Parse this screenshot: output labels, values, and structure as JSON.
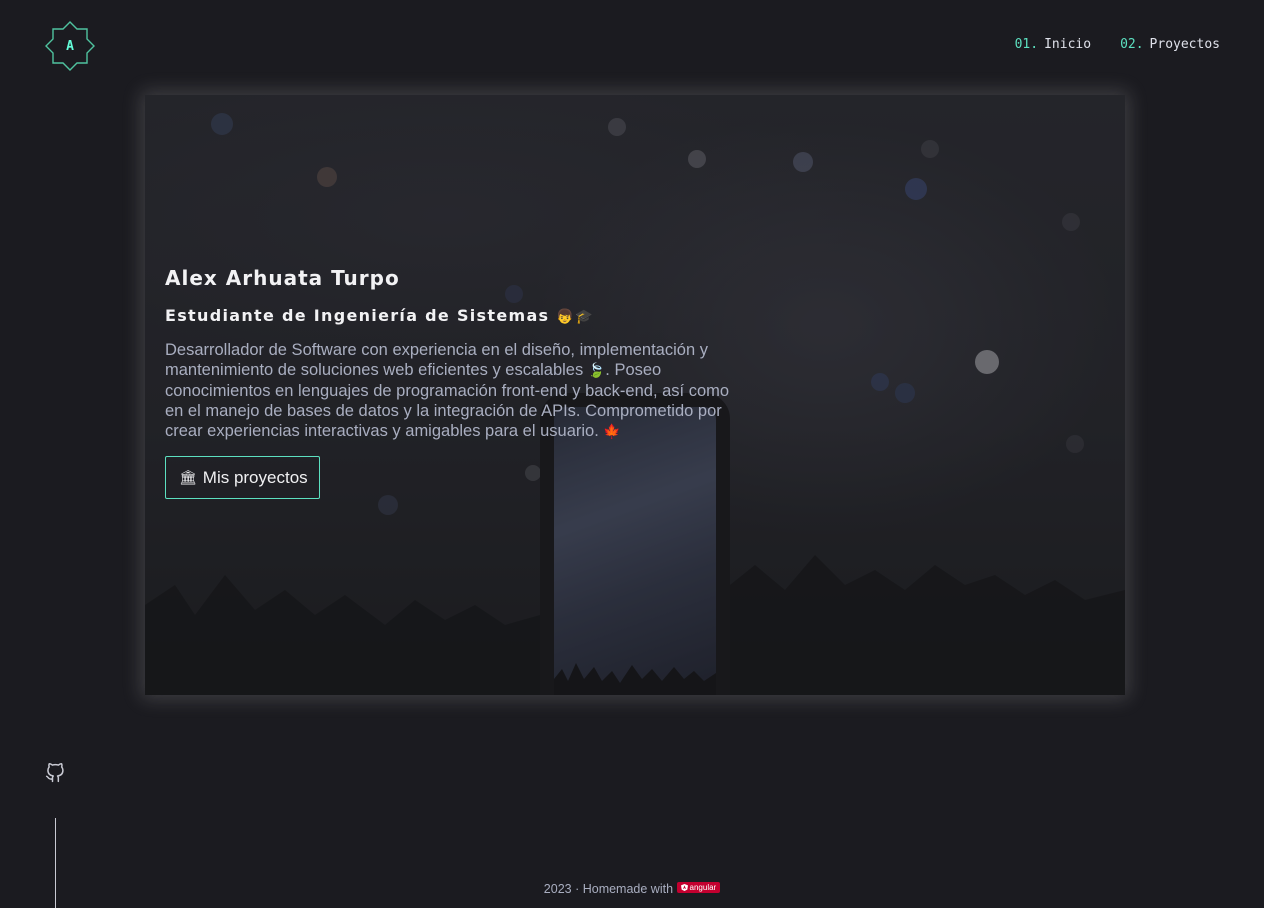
{
  "logo": {
    "letter": "A",
    "icon": "octagram-logo"
  },
  "nav": {
    "items": [
      {
        "num": "01.",
        "label": "Inicio"
      },
      {
        "num": "02.",
        "label": "Proyectos"
      }
    ]
  },
  "hero": {
    "name": "Alex Arhuata Turpo",
    "role": "Estudiante de Ingeniería de Sistemas",
    "role_emojis": "👦🎓",
    "desc_part1": "Desarrollador de Software con experiencia en el diseño, implementación y mantenimiento de soluciones web eficientes y escalables",
    "desc_emoji1": "🍃",
    "desc_part2": ". Poseo conocimientos en lenguajes de programación front-end y back-end, así como en el manejo de bases de datos y la integración de APIs. Comprometido por crear experiencias interactivas y amigables para el usuario.",
    "desc_emoji2": "🍁",
    "button_icon": "🏛",
    "button_label": "Mis proyectos"
  },
  "social": {
    "github_icon": "github-icon"
  },
  "footer": {
    "text": "2023 · Homemade with",
    "badge": "angular"
  },
  "colors": {
    "background": "#1b1b20",
    "accent": "#5ce0c0",
    "text": "#a9aec0",
    "heading": "#f2f2f4"
  }
}
